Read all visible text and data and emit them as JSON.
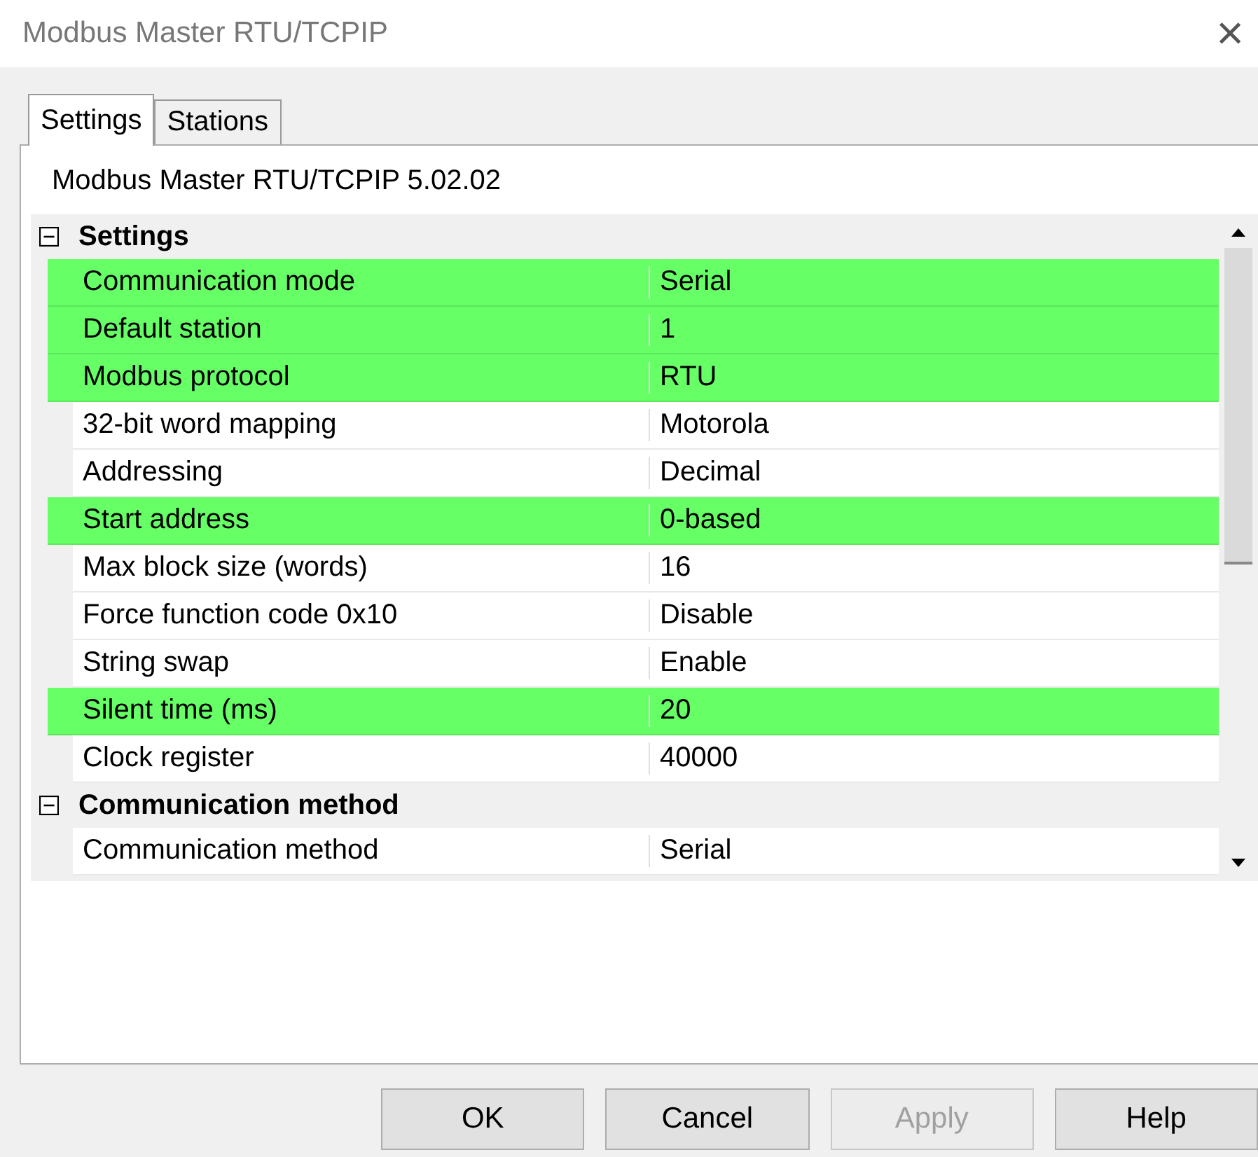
{
  "window": {
    "title": "Modbus Master RTU/TCPIP",
    "close": "×"
  },
  "tabs": [
    {
      "label": "Settings",
      "selected": true
    },
    {
      "label": "Stations",
      "selected": false
    }
  ],
  "version": "Modbus Master RTU/TCPIP 5.02.02",
  "grid": {
    "categories": [
      {
        "name": "Settings",
        "expanded": true,
        "rows": [
          {
            "name": "Communication mode",
            "value": "Serial",
            "highlighted": true
          },
          {
            "name": "Default station",
            "value": "1",
            "highlighted": true
          },
          {
            "name": "Modbus protocol",
            "value": "RTU",
            "highlighted": true
          },
          {
            "name": "32-bit word mapping",
            "value": "Motorola",
            "highlighted": false
          },
          {
            "name": "Addressing",
            "value": "Decimal",
            "highlighted": false
          },
          {
            "name": "Start address",
            "value": "0-based",
            "highlighted": true
          },
          {
            "name": "Max block size (words)",
            "value": "16",
            "highlighted": false
          },
          {
            "name": "Force function code 0x10",
            "value": "Disable",
            "highlighted": false
          },
          {
            "name": "String swap",
            "value": "Enable",
            "highlighted": false
          },
          {
            "name": "Silent time (ms)",
            "value": "20",
            "highlighted": true
          },
          {
            "name": "Clock register",
            "value": "40000",
            "highlighted": false
          }
        ]
      },
      {
        "name": "Communication method",
        "expanded": true,
        "rows": [
          {
            "name": "Communication method",
            "value": "Serial",
            "highlighted": false
          }
        ]
      }
    ]
  },
  "buttons": [
    {
      "label": "OK",
      "disabled": false
    },
    {
      "label": "Cancel",
      "disabled": false
    },
    {
      "label": "Apply",
      "disabled": true
    },
    {
      "label": "Help",
      "disabled": false
    }
  ]
}
